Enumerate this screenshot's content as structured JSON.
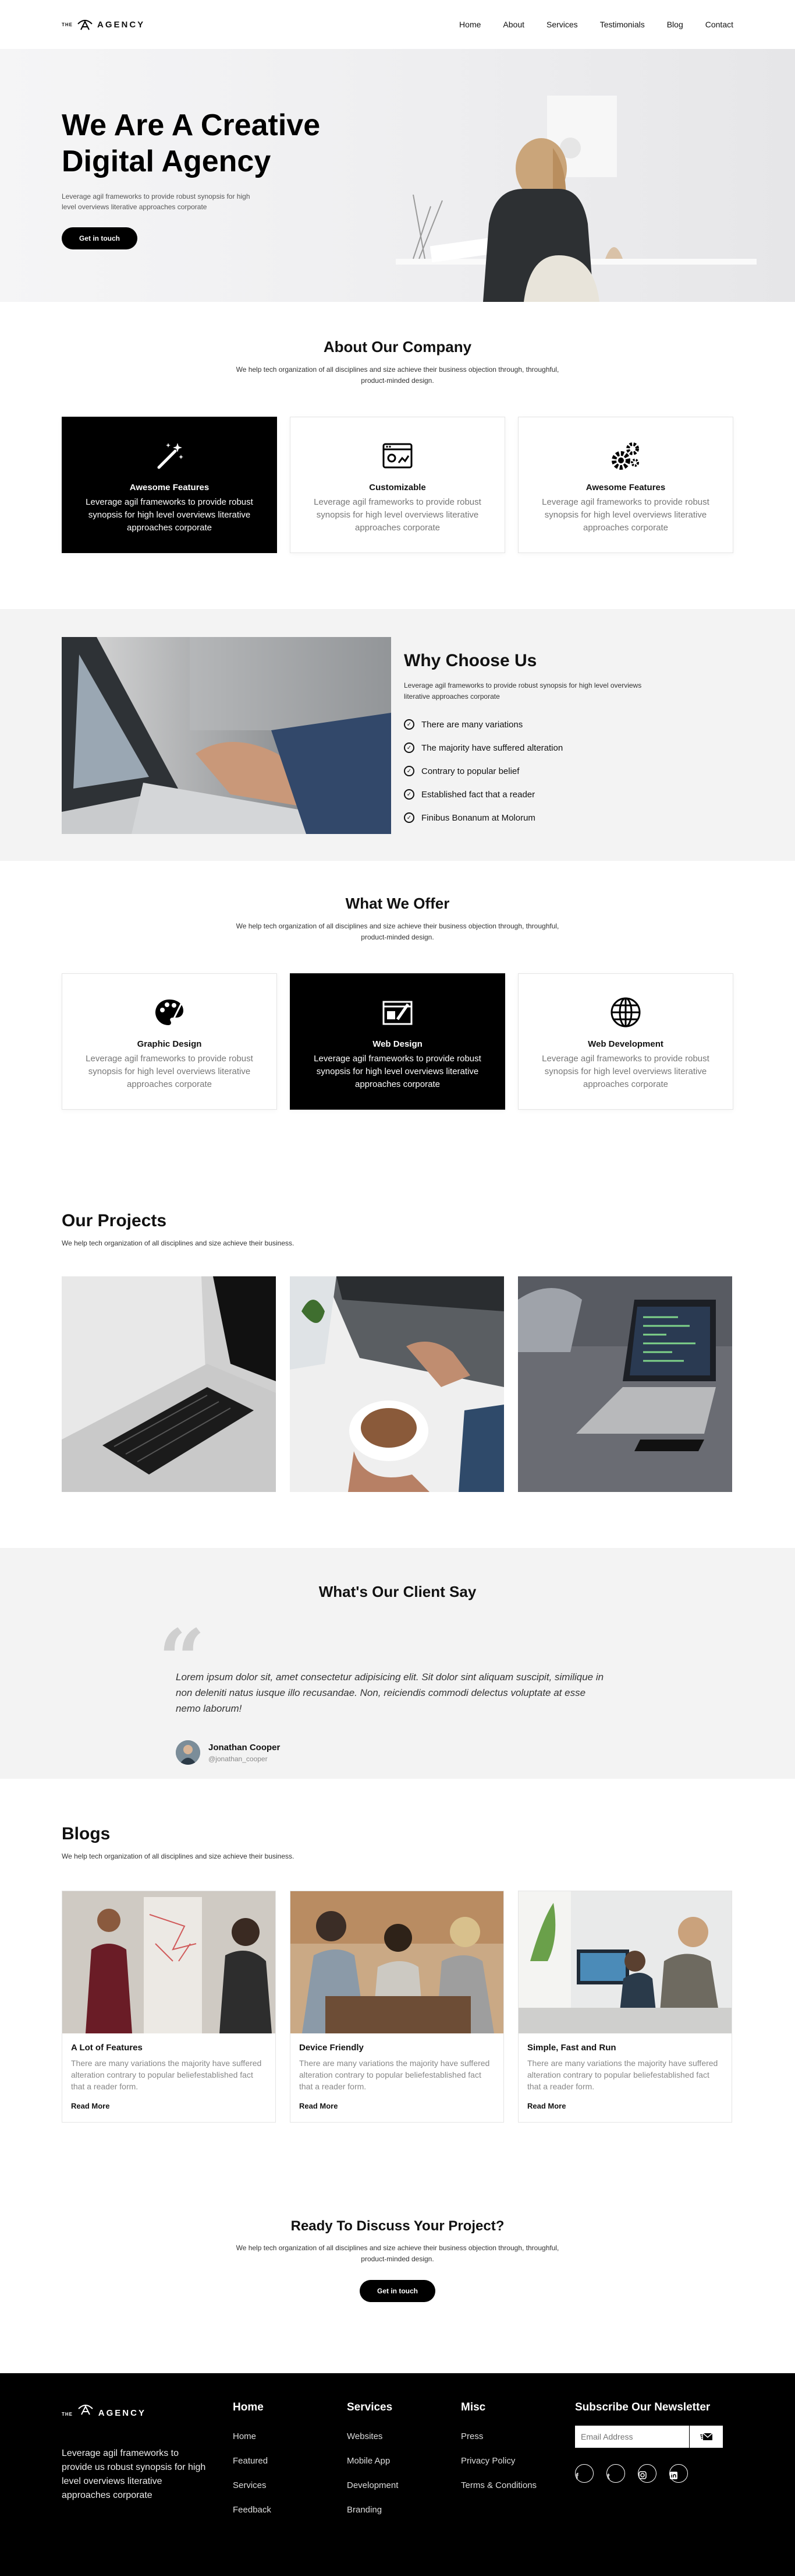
{
  "nav": {
    "logo_the": "THE",
    "logo_name": "AGENCY",
    "items": [
      "Home",
      "About",
      "Services",
      "Testimonials",
      "Blog",
      "Contact"
    ]
  },
  "hero": {
    "title_line1": "We Are A Creative",
    "title_line2": "Digital Agency",
    "subtitle": "Leverage agil frameworks to provide robust synopsis for high level overviews literative approaches corporate",
    "cta": "Get in touch"
  },
  "about": {
    "title": "About Our Company",
    "subtitle": "We help tech organization of all disciplines and size achieve their business objection through, throughful, product-minded design.",
    "cards": [
      {
        "title": "Awesome Features",
        "text": "Leverage agil frameworks to provide robust synopsis for high level overviews literative approaches corporate",
        "icon": "magic-wand-icon"
      },
      {
        "title": "Customizable",
        "text": "Leverage agil frameworks to provide robust synopsis for high level overviews literative approaches corporate",
        "icon": "browser-settings-icon"
      },
      {
        "title": "Awesome Features",
        "text": "Leverage agil frameworks to provide robust synopsis for high level overviews literative approaches corporate",
        "icon": "gears-icon"
      }
    ]
  },
  "why": {
    "title": "Why Choose Us",
    "lead": "Leverage agil frameworks to provide robust synopsis for high level overviews literative approaches corporate",
    "items": [
      "There are many variations",
      "The majority have suffered alteration",
      "Contrary to popular belief",
      "Established fact that a reader",
      "Finibus Bonanum at Molorum"
    ]
  },
  "offer": {
    "title": "What We Offer",
    "subtitle": "We help tech organization of all disciplines and size achieve their business objection through, throughful, product-minded design.",
    "cards": [
      {
        "title": "Graphic Design",
        "text": "Leverage agil frameworks to provide robust synopsis for high level overviews literative approaches corporate",
        "icon": "palette-icon"
      },
      {
        "title": "Web Design",
        "text": "Leverage agil frameworks to provide robust synopsis for high level overviews literative approaches corporate",
        "icon": "web-design-icon"
      },
      {
        "title": "Web Development",
        "text": "Leverage agil frameworks to provide robust synopsis for high level overviews literative approaches corporate",
        "icon": "globe-icon"
      }
    ]
  },
  "projects": {
    "title": "Our Projects",
    "subtitle": "We help tech organization of all disciplines and size achieve their business."
  },
  "testimonial": {
    "title": "What's Our Client Say",
    "quote": "Lorem ipsum dolor sit, amet consectetur adipisicing elit. Sit dolor sint aliquam suscipit, similique in non deleniti natus iusque illo recusandae. Non, reiciendis commodi delectus voluptate at esse nemo laborum!",
    "name": "Jonathan Cooper",
    "handle": "@jonathan_cooper"
  },
  "blogs": {
    "title": "Blogs",
    "subtitle": "We help tech organization of all disciplines and size achieve their business.",
    "posts": [
      {
        "title": "A Lot of Features",
        "text": "There are many variations the majority have suffered alteration contrary to popular beliefestablished fact that a reader form.",
        "link": "Read More"
      },
      {
        "title": "Device Friendly",
        "text": "There are many variations the majority have suffered alteration contrary to popular beliefestablished fact that a reader form.",
        "link": "Read More"
      },
      {
        "title": "Simple, Fast and Run",
        "text": "There are many variations the majority have suffered alteration contrary to popular beliefestablished fact that a reader form.",
        "link": "Read More"
      }
    ]
  },
  "cta": {
    "title": "Ready To Discuss Your Project?",
    "subtitle": "We help tech organization of all disciplines and size achieve their business objection through, throughful, product-minded design.",
    "button": "Get in touch"
  },
  "footer": {
    "about": "Leverage agil frameworks to provide us robust synopsis for high level overviews literative approaches corporate",
    "home": {
      "title": "Home",
      "links": [
        "Home",
        "Featured",
        "Services",
        "Feedback"
      ]
    },
    "services": {
      "title": "Services",
      "links": [
        "Websites",
        "Mobile App",
        "Development",
        "Branding"
      ]
    },
    "misc": {
      "title": "Misc",
      "links": [
        "Press",
        "Privacy Policy",
        "Terms & Conditions"
      ]
    },
    "newsletter": {
      "title": "Subscribe Our Newsletter",
      "placeholder": "Email Address"
    },
    "socials": [
      "facebook-icon",
      "twitter-icon",
      "instagram-icon",
      "linkedin-icon"
    ]
  }
}
